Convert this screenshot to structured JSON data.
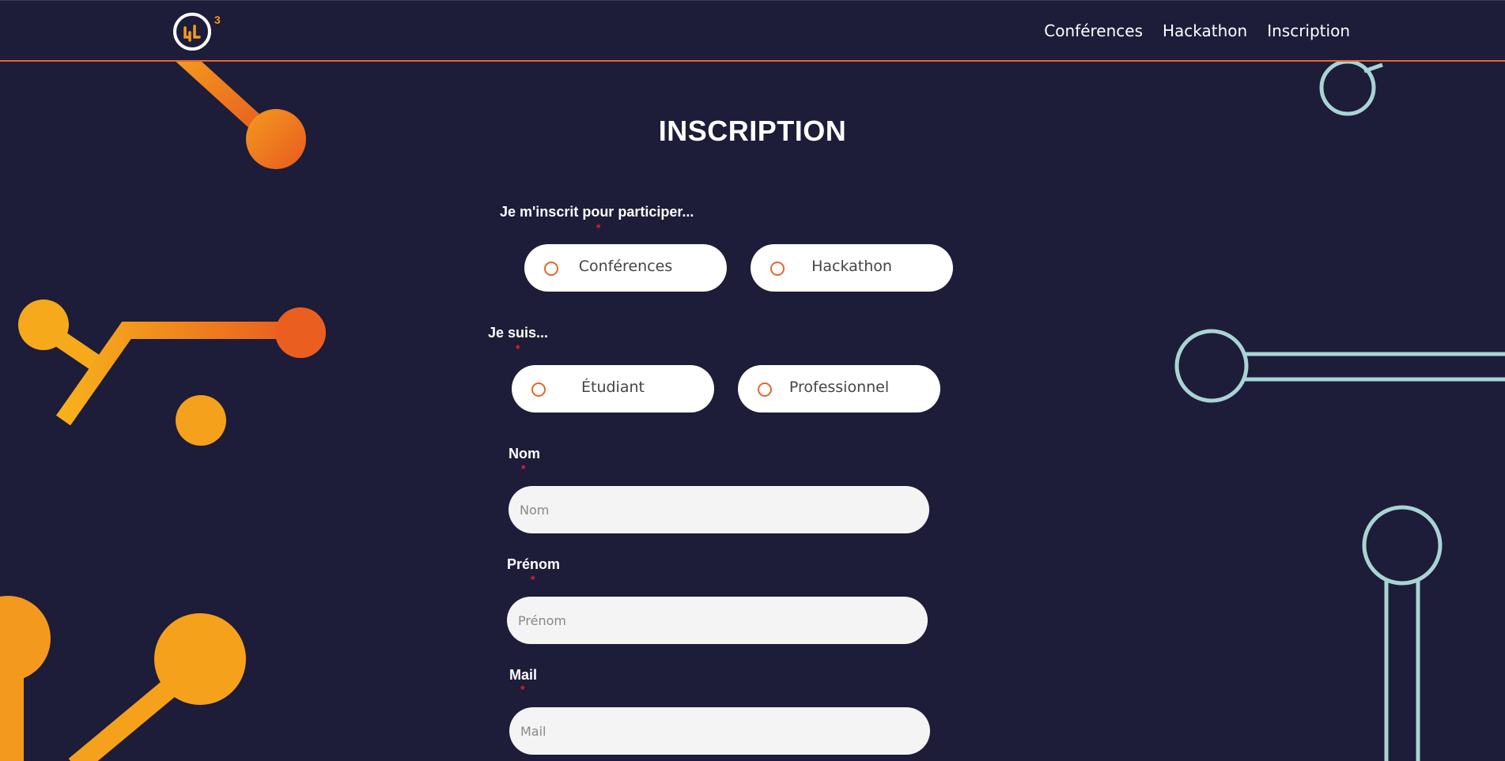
{
  "header": {
    "logo_sup": "3",
    "nav": [
      "Conférences",
      "Hackathon",
      "Inscription"
    ]
  },
  "page_title": "INSCRIPTION",
  "form": {
    "participation": {
      "label": "Je m'inscrit pour participer...",
      "required_mark": "*",
      "options": [
        "Conférences",
        "Hackathon"
      ]
    },
    "status": {
      "label": "Je suis...",
      "required_mark": "*",
      "options": [
        "Étudiant",
        "Professionnel"
      ]
    },
    "nom": {
      "label": "Nom",
      "required_mark": "*",
      "placeholder": "Nom",
      "value": ""
    },
    "prenom": {
      "label": "Prénom",
      "required_mark": "*",
      "placeholder": "Prénom",
      "value": ""
    },
    "mail": {
      "label": "Mail",
      "required_mark": "*",
      "placeholder": "Mail",
      "value": ""
    }
  },
  "colors": {
    "background": "#1d1c39",
    "accent": "#e8652a",
    "circuit_orange": "#f39a1e",
    "circuit_teal": "#a8d4d4",
    "required": "#e0222b"
  }
}
